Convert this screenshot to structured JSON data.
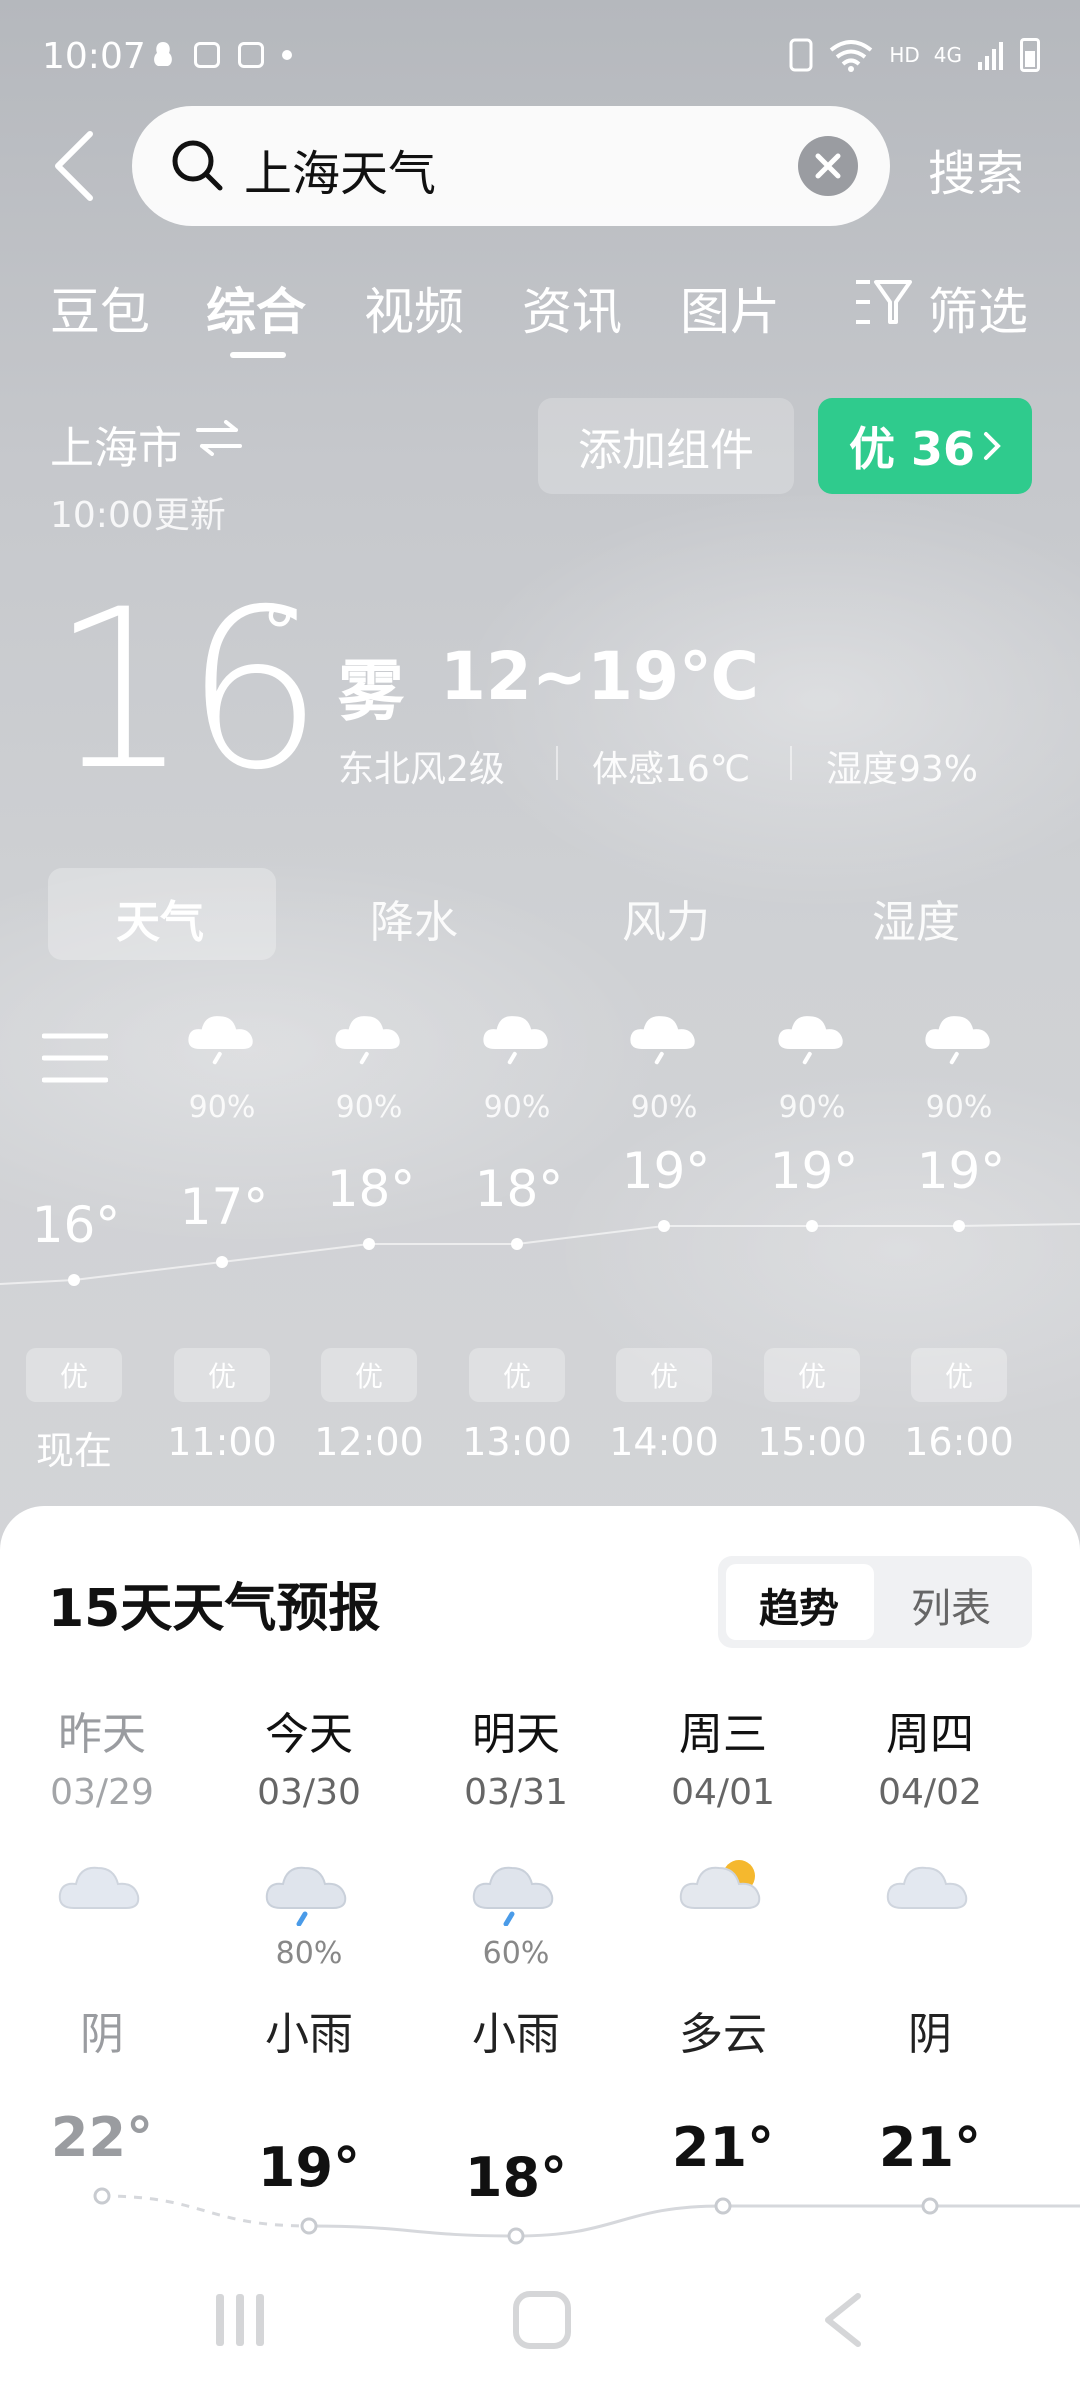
{
  "status_bar": {
    "time": "10:07",
    "net_label": "HD",
    "net_type": "4G"
  },
  "search": {
    "query": "上海天气",
    "button": "搜索"
  },
  "tabs": [
    {
      "label": "豆包",
      "active": false
    },
    {
      "label": "综合",
      "active": true
    },
    {
      "label": "视频",
      "active": false
    },
    {
      "label": "资讯",
      "active": false
    },
    {
      "label": "图片",
      "active": false
    }
  ],
  "filter_label": "筛选",
  "weather": {
    "city": "上海市",
    "update_time": "10:00更新",
    "add_widget": "添加组件",
    "aqi": "优 36",
    "current_temp": "16",
    "degree": "°",
    "condition": "雾",
    "range": "12~19℃",
    "wind": "东北风2级",
    "feels_like": "体感16℃",
    "humidity": "湿度93%"
  },
  "subtabs": [
    {
      "label": "天气",
      "active": true
    },
    {
      "label": "降水",
      "active": false
    },
    {
      "label": "风力",
      "active": false
    },
    {
      "label": "湿度",
      "active": false
    }
  ],
  "hourly": [
    {
      "time": "现在",
      "temp": "16°",
      "temp_value": 16,
      "precip": "",
      "aqi": "优"
    },
    {
      "time": "11:00",
      "temp": "17°",
      "temp_value": 17,
      "precip": "90%",
      "aqi": "优"
    },
    {
      "time": "12:00",
      "temp": "18°",
      "temp_value": 18,
      "precip": "90%",
      "aqi": "优"
    },
    {
      "time": "13:00",
      "temp": "18°",
      "temp_value": 18,
      "precip": "90%",
      "aqi": "优"
    },
    {
      "time": "14:00",
      "temp": "19°",
      "temp_value": 19,
      "precip": "90%",
      "aqi": "优"
    },
    {
      "time": "15:00",
      "temp": "19°",
      "temp_value": 19,
      "precip": "90%",
      "aqi": "优"
    },
    {
      "time": "16:00",
      "temp": "19°",
      "temp_value": 19,
      "precip": "90%",
      "aqi": "优"
    }
  ],
  "forecast": {
    "title": "15天天气预报",
    "toggle": {
      "trend": "趋势",
      "list": "列表"
    },
    "days": [
      {
        "name": "昨天",
        "date": "03/29",
        "cond": "阴",
        "precip": "",
        "temp": "22°",
        "temp_value": 22,
        "icon": "cloudy-icon",
        "past": true
      },
      {
        "name": "今天",
        "date": "03/30",
        "cond": "小雨",
        "precip": "80%",
        "temp": "19°",
        "temp_value": 19,
        "icon": "light-rain-icon",
        "past": false
      },
      {
        "name": "明天",
        "date": "03/31",
        "cond": "小雨",
        "precip": "60%",
        "temp": "18°",
        "temp_value": 18,
        "icon": "light-rain-icon",
        "past": false
      },
      {
        "name": "周三",
        "date": "04/01",
        "cond": "多云",
        "precip": "",
        "temp": "21°",
        "temp_value": 21,
        "icon": "partly-cloudy-icon",
        "past": false
      },
      {
        "name": "周四",
        "date": "04/02",
        "cond": "阴",
        "precip": "",
        "temp": "21°",
        "temp_value": 21,
        "icon": "cloudy-icon",
        "past": false
      }
    ]
  },
  "colors": {
    "aqi_green": "#2fcb8d",
    "rain_blue": "#4a9be8",
    "sun_yellow": "#f5b82e"
  }
}
